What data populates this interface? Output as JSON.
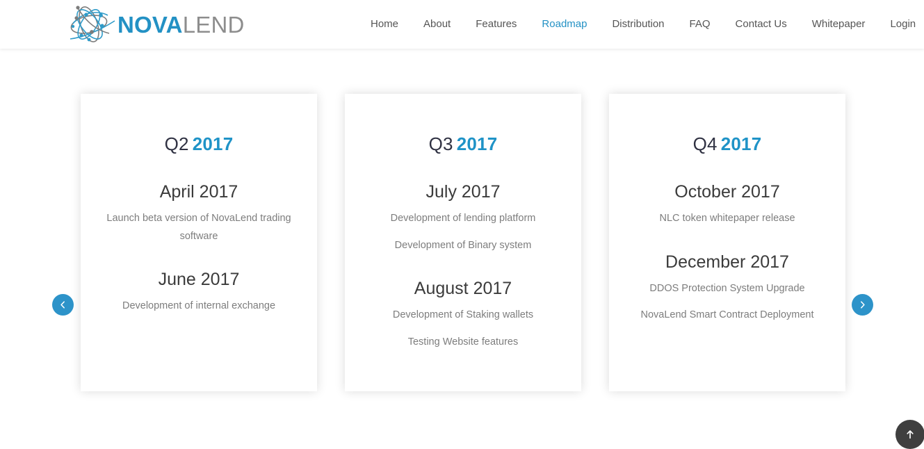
{
  "header": {
    "brand": {
      "logo_icon": "novalend-network-logo-icon",
      "name_primary": "NOVA",
      "name_secondary": "LEND",
      "primary_color": "#2391c4",
      "secondary_color": "#8d8d8d"
    },
    "nav": {
      "active": "Roadmap",
      "active_color": "#2391c4",
      "items": [
        {
          "label": "Home"
        },
        {
          "label": "About"
        },
        {
          "label": "Features"
        },
        {
          "label": "Roadmap"
        },
        {
          "label": "Distribution"
        },
        {
          "label": "FAQ"
        },
        {
          "label": "Contact Us"
        },
        {
          "label": "Whitepaper"
        },
        {
          "label": "Login"
        }
      ]
    }
  },
  "roadmap": {
    "accent_color": "#1f93c7",
    "cards": [
      {
        "quarter": "Q2",
        "year": "2017",
        "milestones": [
          {
            "date": "April 2017",
            "items": [
              "Launch beta version of NovaLend trading software"
            ]
          },
          {
            "date": "June 2017",
            "items": [
              "Development of internal exchange"
            ]
          }
        ]
      },
      {
        "quarter": "Q3",
        "year": "2017",
        "milestones": [
          {
            "date": "July 2017",
            "items": [
              "Development of lending platform",
              "Development of Binary system"
            ]
          },
          {
            "date": "August 2017",
            "items": [
              "Development of Staking wallets",
              "Testing Website features"
            ]
          }
        ]
      },
      {
        "quarter": "Q4",
        "year": "2017",
        "milestones": [
          {
            "date": "October 2017",
            "items": [
              "NLC token whitepaper release"
            ]
          },
          {
            "date": "December 2017",
            "items": [
              "DDOS Protection System Upgrade",
              "NovaLend Smart Contract Deployment"
            ]
          }
        ]
      }
    ],
    "controls": {
      "prev_icon": "chevron-left-icon",
      "next_icon": "chevron-right-icon",
      "prev_label": "Previous",
      "next_label": "Next",
      "button_color": "#2d93c9"
    }
  },
  "scroll_top": {
    "icon": "arrow-up-icon",
    "label": "Scroll to top",
    "color": "#3f3f3f"
  }
}
